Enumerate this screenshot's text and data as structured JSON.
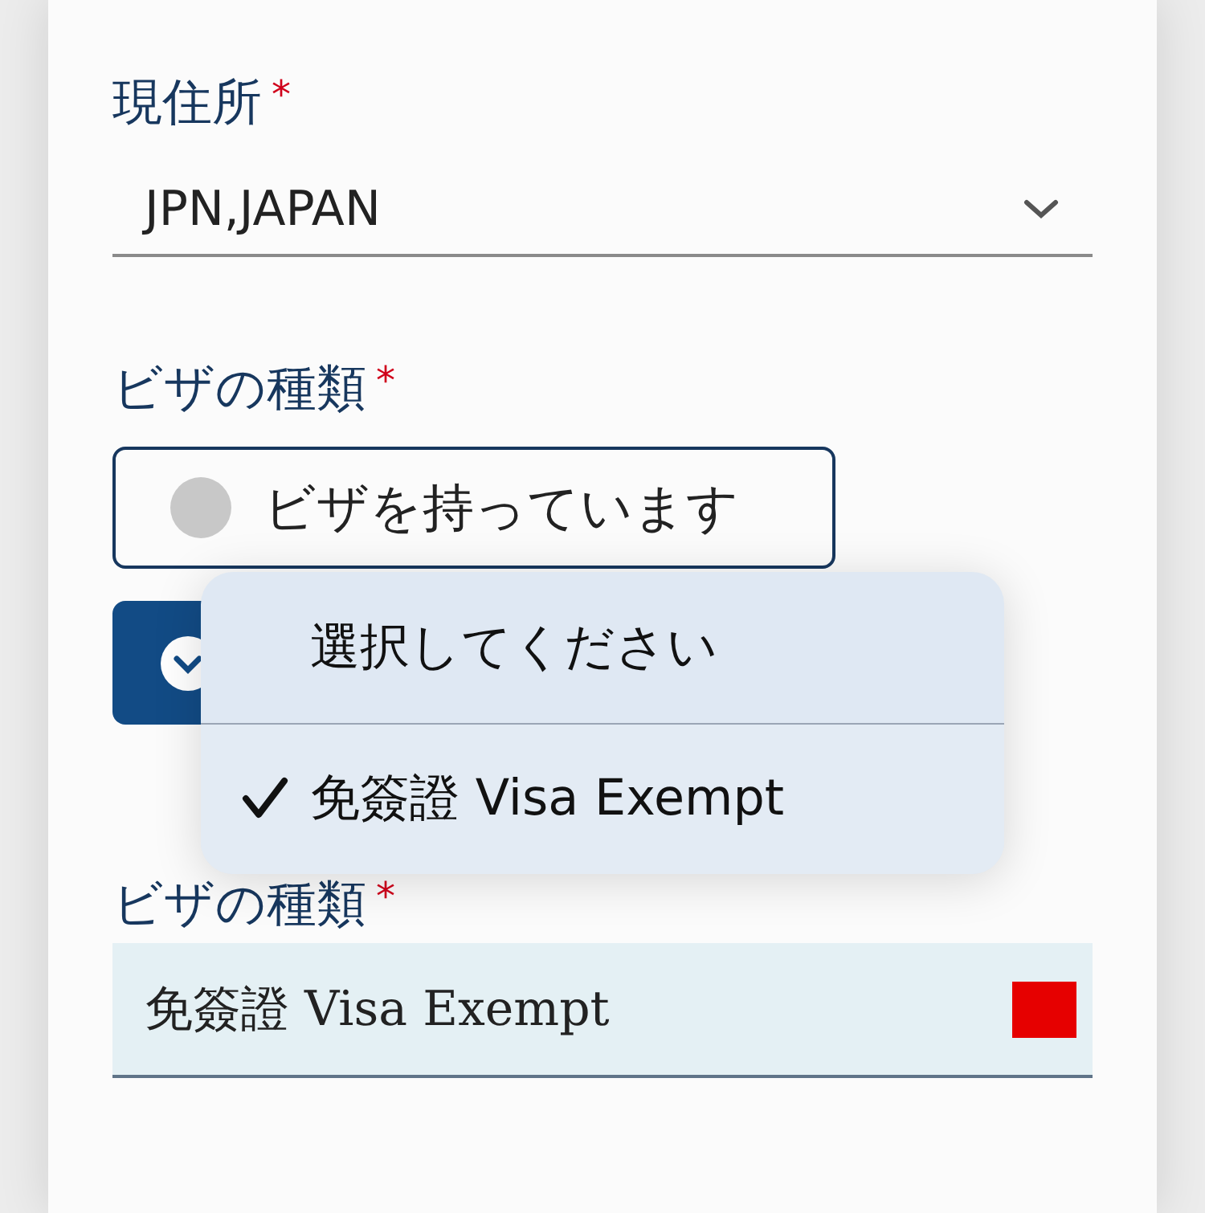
{
  "residence": {
    "label": "現住所",
    "required_mark": "*",
    "value": "JPN,JAPAN"
  },
  "visa_status": {
    "label": "ビザの種類",
    "required_mark": "*",
    "options": [
      {
        "label": "ビザを持っています",
        "selected": false
      }
    ]
  },
  "picker_menu": {
    "items": [
      {
        "label": "選択してください",
        "selected": false
      },
      {
        "label": "免簽證 Visa Exempt",
        "selected": true
      }
    ]
  },
  "visa_type": {
    "label": "ビザの種類",
    "required_mark": "*",
    "value": "免簽證 Visa Exempt"
  }
}
